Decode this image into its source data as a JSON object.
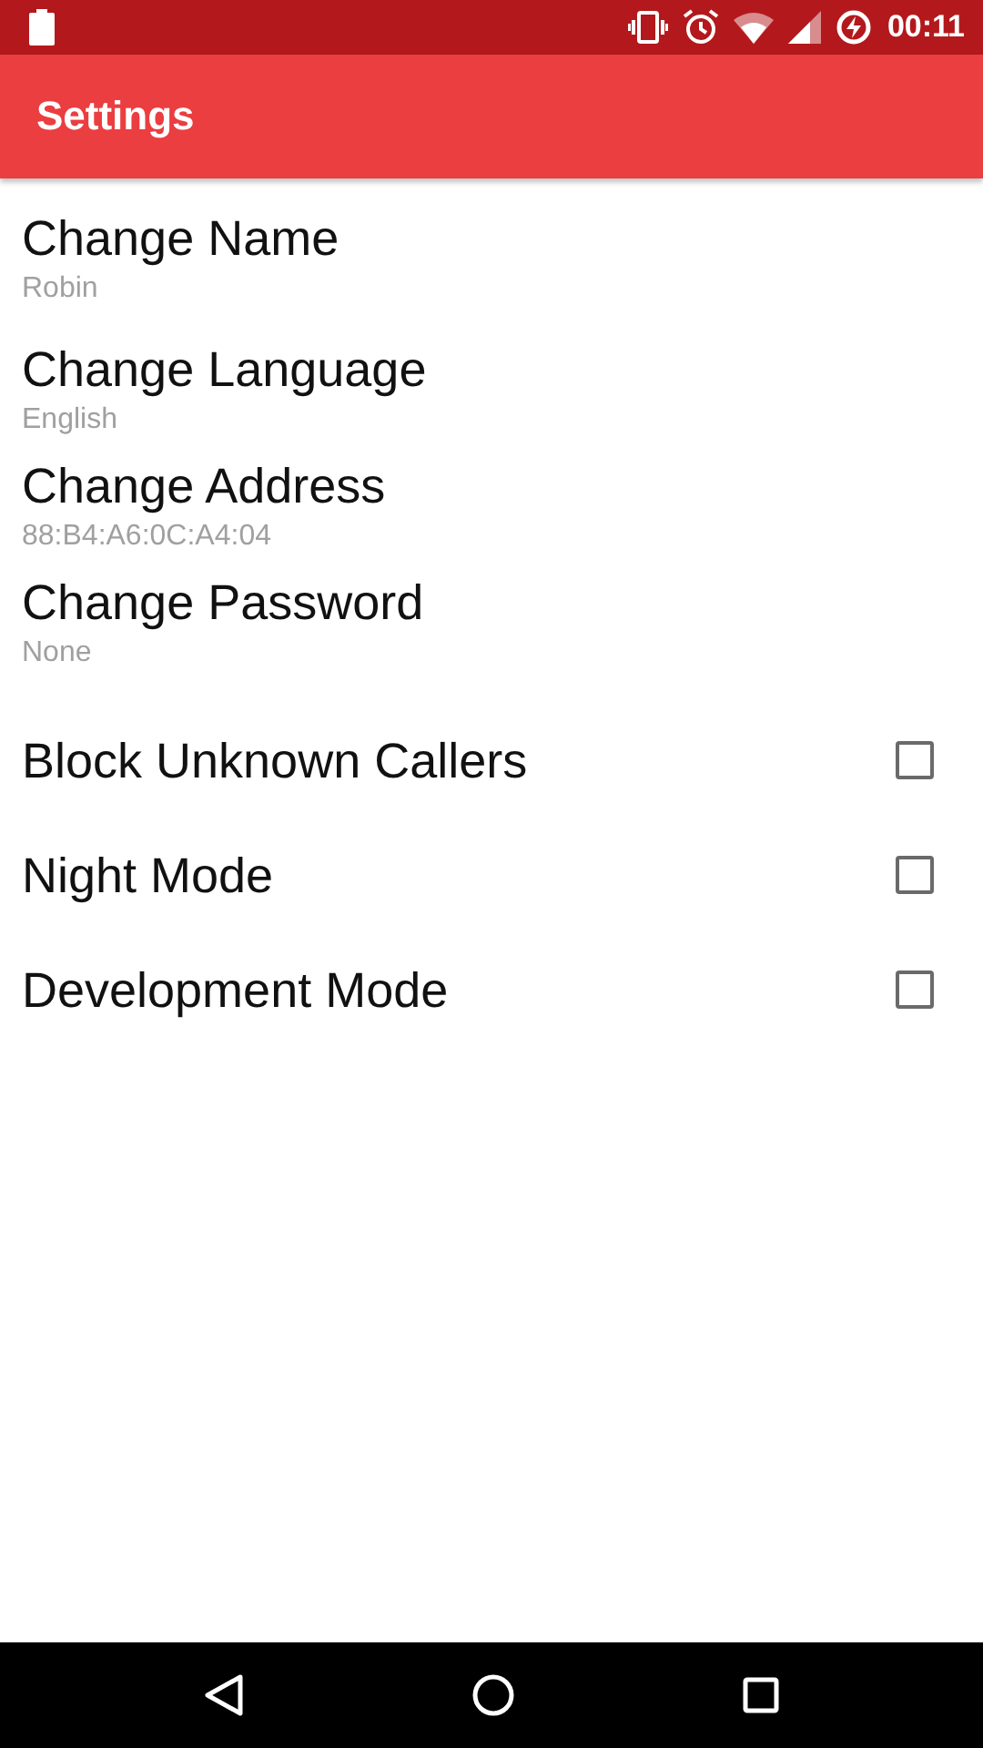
{
  "status_bar": {
    "time": "00:11"
  },
  "app_bar": {
    "title": "Settings"
  },
  "items": [
    {
      "kind": "text",
      "title": "Change Name",
      "summary": "Robin"
    },
    {
      "kind": "text",
      "title": "Change Language",
      "summary": "English"
    },
    {
      "kind": "text",
      "title": "Change Address",
      "summary": "88:B4:A6:0C:A4:04"
    },
    {
      "kind": "text",
      "title": "Change Password",
      "summary": "None"
    },
    {
      "kind": "checkbox",
      "title": "Block Unknown Callers",
      "checked": false
    },
    {
      "kind": "checkbox",
      "title": "Night Mode",
      "checked": false
    },
    {
      "kind": "checkbox",
      "title": "Development Mode",
      "checked": false
    }
  ]
}
